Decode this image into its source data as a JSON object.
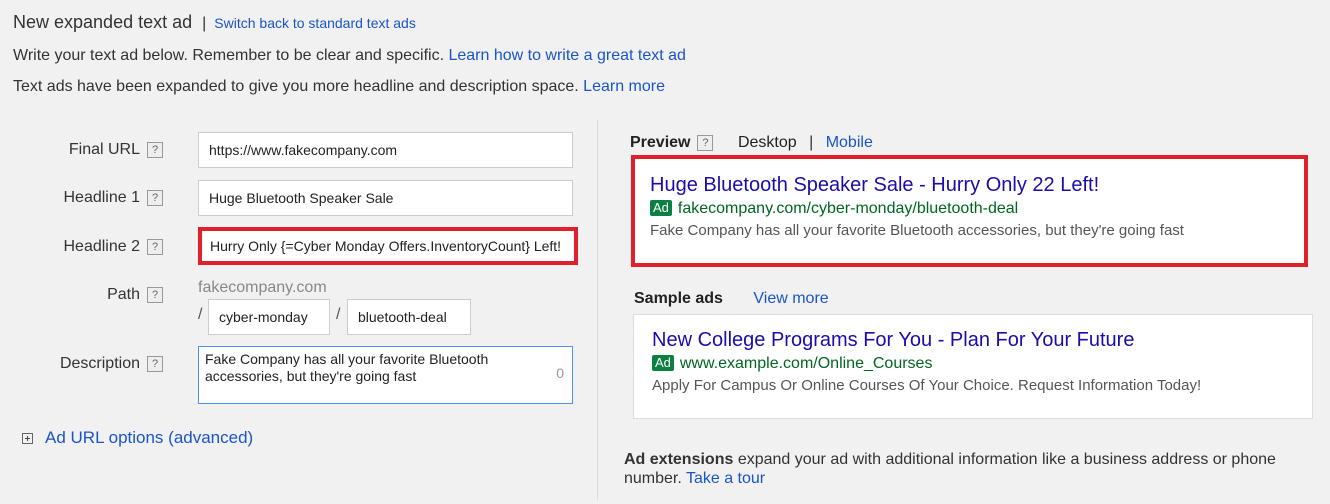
{
  "header": {
    "title": "New expanded text ad",
    "separator": "|",
    "switch_link": "Switch back to standard text ads"
  },
  "intro": {
    "line1_text": "Write your text ad below. Remember to be clear and specific.",
    "line1_link": "Learn how to write a great text ad",
    "line2_text": "Text ads have been expanded to give you more headline and description space.",
    "line2_link": "Learn more"
  },
  "form": {
    "help_glyph": "?",
    "final_url": {
      "label": "Final URL",
      "value": "https://www.fakecompany.com"
    },
    "headline1": {
      "label": "Headline 1",
      "value": "Huge Bluetooth Speaker Sale"
    },
    "headline2": {
      "label": "Headline 2",
      "value": "Hurry Only {=Cyber Monday Offers.InventoryCount} Left!"
    },
    "path": {
      "label": "Path",
      "domain": "fakecompany.com",
      "slash": "/",
      "path1": "cyber-monday",
      "path2": "bluetooth-deal"
    },
    "description": {
      "label": "Description",
      "value": "Fake Company has all your favorite Bluetooth accessories, but they're going fast",
      "counter": "0"
    },
    "ad_url_options": "Ad URL options (advanced)"
  },
  "preview": {
    "label": "Preview",
    "desktop": "Desktop",
    "separator": "|",
    "mobile": "Mobile",
    "ad": {
      "headline": "Huge Bluetooth Speaker Sale - Hurry Only 22 Left!",
      "badge": "Ad",
      "display_url": "fakecompany.com/cyber-monday/bluetooth-deal",
      "description": "Fake Company has all your favorite Bluetooth accessories, but they're going fast"
    }
  },
  "sample_ads": {
    "label": "Sample ads",
    "view_more": "View more",
    "ad": {
      "headline": "New College Programs For You - Plan For Your Future",
      "badge": "Ad",
      "display_url": "www.example.com/Online_Courses",
      "description": "Apply For Campus Or Online Courses Of Your Choice. Request Information Today!"
    }
  },
  "extensions": {
    "bold": "Ad extensions",
    "text": "expand your ad with additional information like a business address or phone number.",
    "link": "Take a tour"
  },
  "colors": {
    "highlight_border": "#e0202a",
    "link": "#1a55c9",
    "ad_headline": "#1a0dab",
    "ad_url": "#006621",
    "ad_badge": "#0b8043"
  }
}
